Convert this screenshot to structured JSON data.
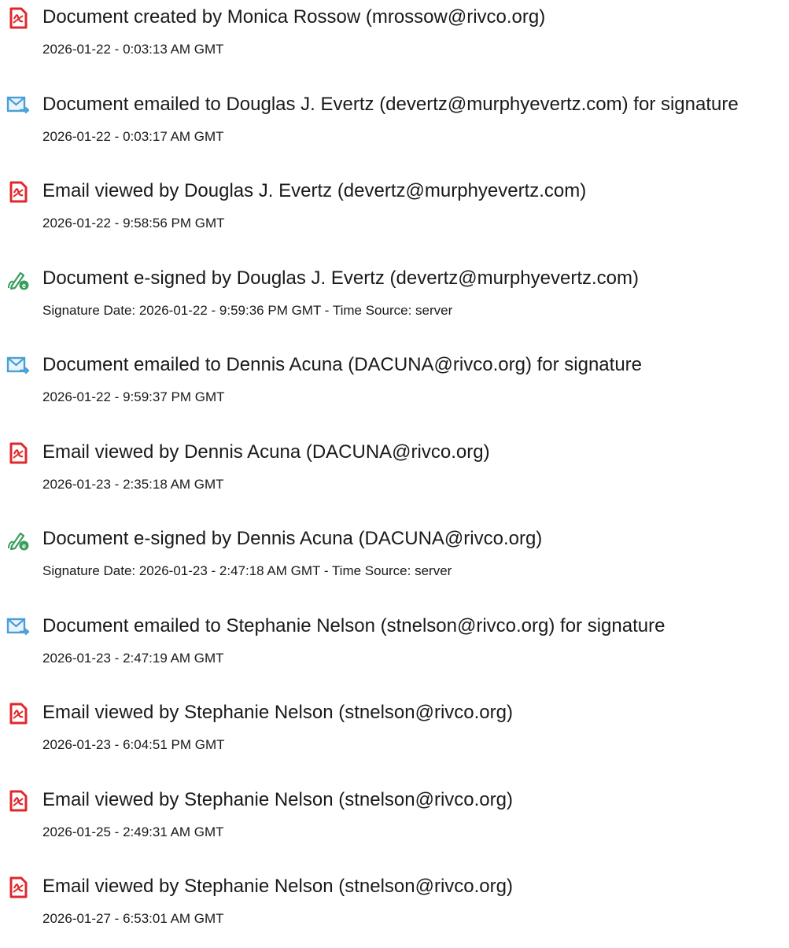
{
  "events": [
    {
      "icon": "pdf-document-icon",
      "title": "Document created by Monica Rossow (mrossow@rivco.org)",
      "detail": "2026-01-22 - 0:03:13 AM GMT"
    },
    {
      "icon": "email-sent-icon",
      "title": "Document emailed to Douglas J. Evertz (devertz@murphyevertz.com) for signature",
      "detail": "2026-01-22 - 0:03:17 AM GMT"
    },
    {
      "icon": "pdf-document-icon",
      "title": "Email viewed by Douglas J. Evertz (devertz@murphyevertz.com)",
      "detail": "2026-01-22 - 9:58:56 PM GMT"
    },
    {
      "icon": "e-sign-icon",
      "title": "Document e-signed by Douglas J. Evertz (devertz@murphyevertz.com)",
      "detail": "Signature Date: 2026-01-22 - 9:59:36 PM GMT - Time Source: server"
    },
    {
      "icon": "email-sent-icon",
      "title": "Document emailed to Dennis Acuna (DACUNA@rivco.org) for signature",
      "detail": "2026-01-22 - 9:59:37 PM GMT"
    },
    {
      "icon": "pdf-document-icon",
      "title": "Email viewed by Dennis Acuna (DACUNA@rivco.org)",
      "detail": "2026-01-23 - 2:35:18 AM GMT"
    },
    {
      "icon": "e-sign-icon",
      "title": "Document e-signed by Dennis Acuna (DACUNA@rivco.org)",
      "detail": "Signature Date: 2026-01-23 - 2:47:18 AM GMT - Time Source: server"
    },
    {
      "icon": "email-sent-icon",
      "title": "Document emailed to Stephanie Nelson (stnelson@rivco.org) for signature",
      "detail": "2026-01-23 - 2:47:19 AM GMT"
    },
    {
      "icon": "pdf-document-icon",
      "title": "Email viewed by Stephanie Nelson (stnelson@rivco.org)",
      "detail": "2026-01-23 - 6:04:51 PM GMT"
    },
    {
      "icon": "pdf-document-icon",
      "title": "Email viewed by Stephanie Nelson (stnelson@rivco.org)",
      "detail": "2026-01-25 - 2:49:31 AM GMT"
    },
    {
      "icon": "pdf-document-icon",
      "title": "Email viewed by Stephanie Nelson (stnelson@rivco.org)",
      "detail": "2026-01-27 - 6:53:01 AM GMT"
    }
  ],
  "colors": {
    "pdf_icon": "#e0282c",
    "email_icon": "#4a9fd8",
    "sign_icon": "#3a9e5c",
    "text": "#1a1a1a"
  }
}
